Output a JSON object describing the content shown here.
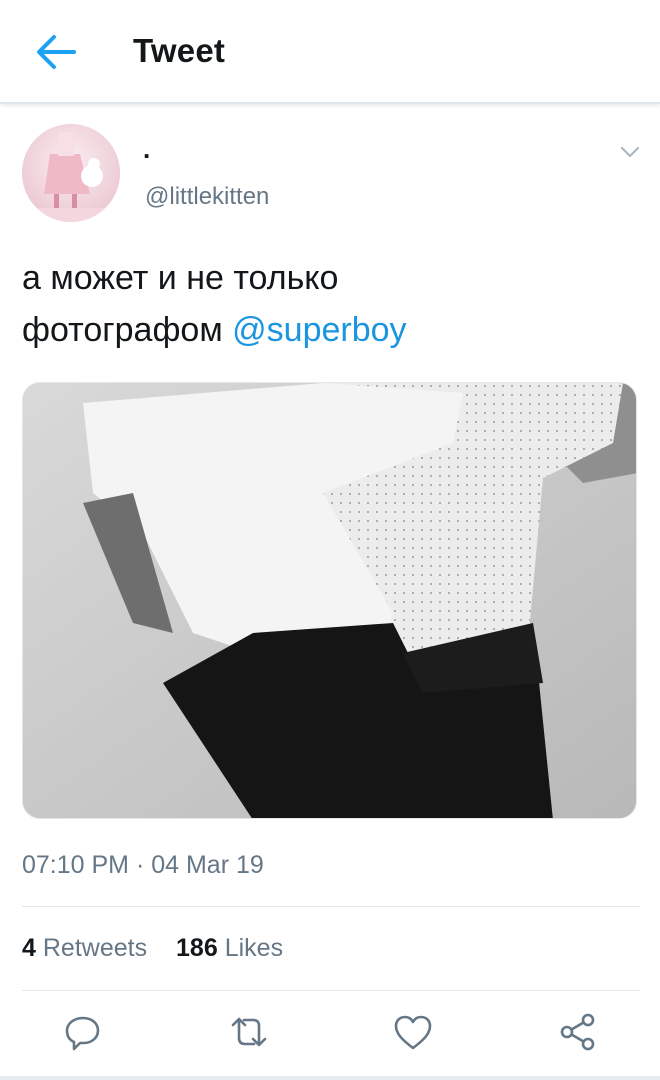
{
  "header": {
    "title": "Tweet",
    "back_icon": "arrow-left-icon",
    "accent": "#1da1f2"
  },
  "author": {
    "display_name": ".",
    "handle": "@littlekitten"
  },
  "tweet": {
    "text_line1": "а может и не только",
    "text_line2": "фотографом",
    "mention": "@superboy",
    "timestamp": "07:10 PM · 04 Mar 19"
  },
  "stats": {
    "retweets_count": "4",
    "retweets_label": "Retweets",
    "likes_count": "186",
    "likes_label": "Likes"
  },
  "actions": [
    "reply-icon",
    "retweet-icon",
    "like-icon",
    "share-icon"
  ],
  "colors": {
    "link": "#1b95e0",
    "secondary_text": "#657786",
    "divider": "#e1e8ed"
  }
}
